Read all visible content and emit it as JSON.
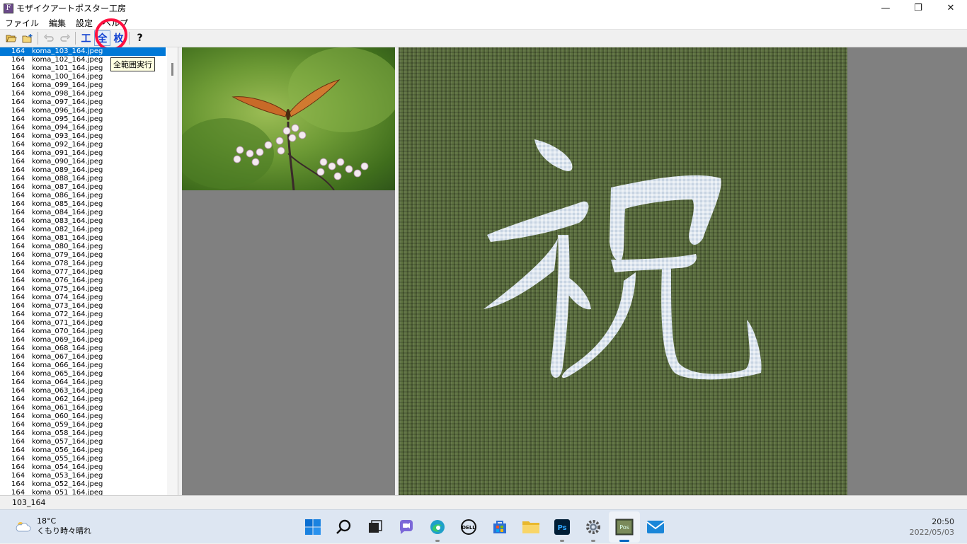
{
  "window": {
    "title": "モザイクアートポスター工房",
    "app_icon_letter": "F",
    "minimize": "—",
    "maximize": "❐",
    "close": "✕"
  },
  "menu": [
    "ファイル",
    "編集",
    "設定",
    "ヘルプ"
  ],
  "toolbar": {
    "zen_label": "全",
    "kou_label": "工",
    "mai_label": "枚",
    "help_label": "?",
    "tooltip": "全範囲実行"
  },
  "file_list": {
    "selected_index": 0,
    "rows": [
      {
        "size": "164",
        "name": "koma_103_164.jpeg"
      },
      {
        "size": "164",
        "name": "koma_102_164.jpeg"
      },
      {
        "size": "164",
        "name": "koma_101_164.jpeg"
      },
      {
        "size": "164",
        "name": "koma_100_164.jpeg"
      },
      {
        "size": "164",
        "name": "koma_099_164.jpeg"
      },
      {
        "size": "164",
        "name": "koma_098_164.jpeg"
      },
      {
        "size": "164",
        "name": "koma_097_164.jpeg"
      },
      {
        "size": "164",
        "name": "koma_096_164.jpeg"
      },
      {
        "size": "164",
        "name": "koma_095_164.jpeg"
      },
      {
        "size": "164",
        "name": "koma_094_164.jpeg"
      },
      {
        "size": "164",
        "name": "koma_093_164.jpeg"
      },
      {
        "size": "164",
        "name": "koma_092_164.jpeg"
      },
      {
        "size": "164",
        "name": "koma_091_164.jpeg"
      },
      {
        "size": "164",
        "name": "koma_090_164.jpeg"
      },
      {
        "size": "164",
        "name": "koma_089_164.jpeg"
      },
      {
        "size": "164",
        "name": "koma_088_164.jpeg"
      },
      {
        "size": "164",
        "name": "koma_087_164.jpeg"
      },
      {
        "size": "164",
        "name": "koma_086_164.jpeg"
      },
      {
        "size": "164",
        "name": "koma_085_164.jpeg"
      },
      {
        "size": "164",
        "name": "koma_084_164.jpeg"
      },
      {
        "size": "164",
        "name": "koma_083_164.jpeg"
      },
      {
        "size": "164",
        "name": "koma_082_164.jpeg"
      },
      {
        "size": "164",
        "name": "koma_081_164.jpeg"
      },
      {
        "size": "164",
        "name": "koma_080_164.jpeg"
      },
      {
        "size": "164",
        "name": "koma_079_164.jpeg"
      },
      {
        "size": "164",
        "name": "koma_078_164.jpeg"
      },
      {
        "size": "164",
        "name": "koma_077_164.jpeg"
      },
      {
        "size": "164",
        "name": "koma_076_164.jpeg"
      },
      {
        "size": "164",
        "name": "koma_075_164.jpeg"
      },
      {
        "size": "164",
        "name": "koma_074_164.jpeg"
      },
      {
        "size": "164",
        "name": "koma_073_164.jpeg"
      },
      {
        "size": "164",
        "name": "koma_072_164.jpeg"
      },
      {
        "size": "164",
        "name": "koma_071_164.jpeg"
      },
      {
        "size": "164",
        "name": "koma_070_164.jpeg"
      },
      {
        "size": "164",
        "name": "koma_069_164.jpeg"
      },
      {
        "size": "164",
        "name": "koma_068_164.jpeg"
      },
      {
        "size": "164",
        "name": "koma_067_164.jpeg"
      },
      {
        "size": "164",
        "name": "koma_066_164.jpeg"
      },
      {
        "size": "164",
        "name": "koma_065_164.jpeg"
      },
      {
        "size": "164",
        "name": "koma_064_164.jpeg"
      },
      {
        "size": "164",
        "name": "koma_063_164.jpeg"
      },
      {
        "size": "164",
        "name": "koma_062_164.jpeg"
      },
      {
        "size": "164",
        "name": "koma_061_164.jpeg"
      },
      {
        "size": "164",
        "name": "koma_060_164.jpeg"
      },
      {
        "size": "164",
        "name": "koma_059_164.jpeg"
      },
      {
        "size": "164",
        "name": "koma_058_164.jpeg"
      },
      {
        "size": "164",
        "name": "koma_057_164.jpeg"
      },
      {
        "size": "164",
        "name": "koma_056_164.jpeg"
      },
      {
        "size": "164",
        "name": "koma_055_164.jpeg"
      },
      {
        "size": "164",
        "name": "koma_054_164.jpeg"
      },
      {
        "size": "164",
        "name": "koma_053_164.jpeg"
      },
      {
        "size": "164",
        "name": "koma_052_164.jpeg"
      },
      {
        "size": "164",
        "name": "koma_051_164.jpeg"
      }
    ]
  },
  "mosaic": {
    "character": "祝"
  },
  "status": {
    "text": "103_164"
  },
  "taskbar": {
    "weather_temp": "18°C",
    "weather_desc": "くもり時々晴れ",
    "time": "20:50",
    "date": "2022/05/03",
    "apps": [
      "start-icon",
      "search-icon",
      "task-view-icon",
      "chat-icon",
      "edge-icon",
      "dell-icon",
      "store-icon",
      "explorer-icon",
      "photoshop-icon",
      "settings-icon",
      "mosaic-app-icon",
      "mail-icon"
    ]
  },
  "colors": {
    "selection": "#0078d7",
    "highlight_circle": "#ff1040",
    "panel_gray": "#808080"
  }
}
